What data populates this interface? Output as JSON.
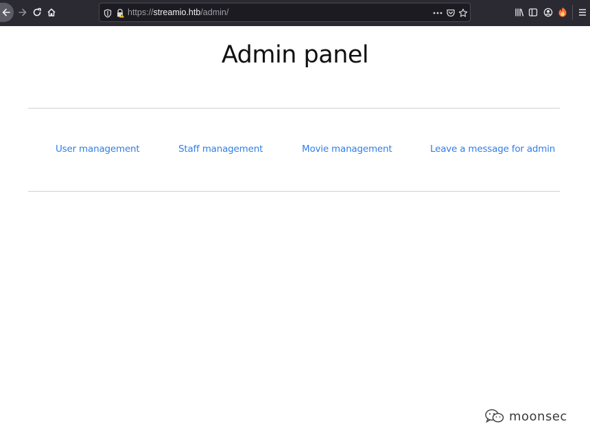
{
  "browser": {
    "url_scheme": "https://",
    "url_host": "streamio.htb",
    "url_path": "/admin/"
  },
  "page": {
    "title": "Admin panel",
    "links": [
      "User management",
      "Staff management",
      "Movie management",
      "Leave a message for admin"
    ]
  },
  "watermark": {
    "text": "moonsec"
  },
  "colors": {
    "chrome_bg": "#2b2a33",
    "urlbar_bg": "#1c1b22",
    "link": "#2f7ee6",
    "rule": "#cfcfcf"
  }
}
